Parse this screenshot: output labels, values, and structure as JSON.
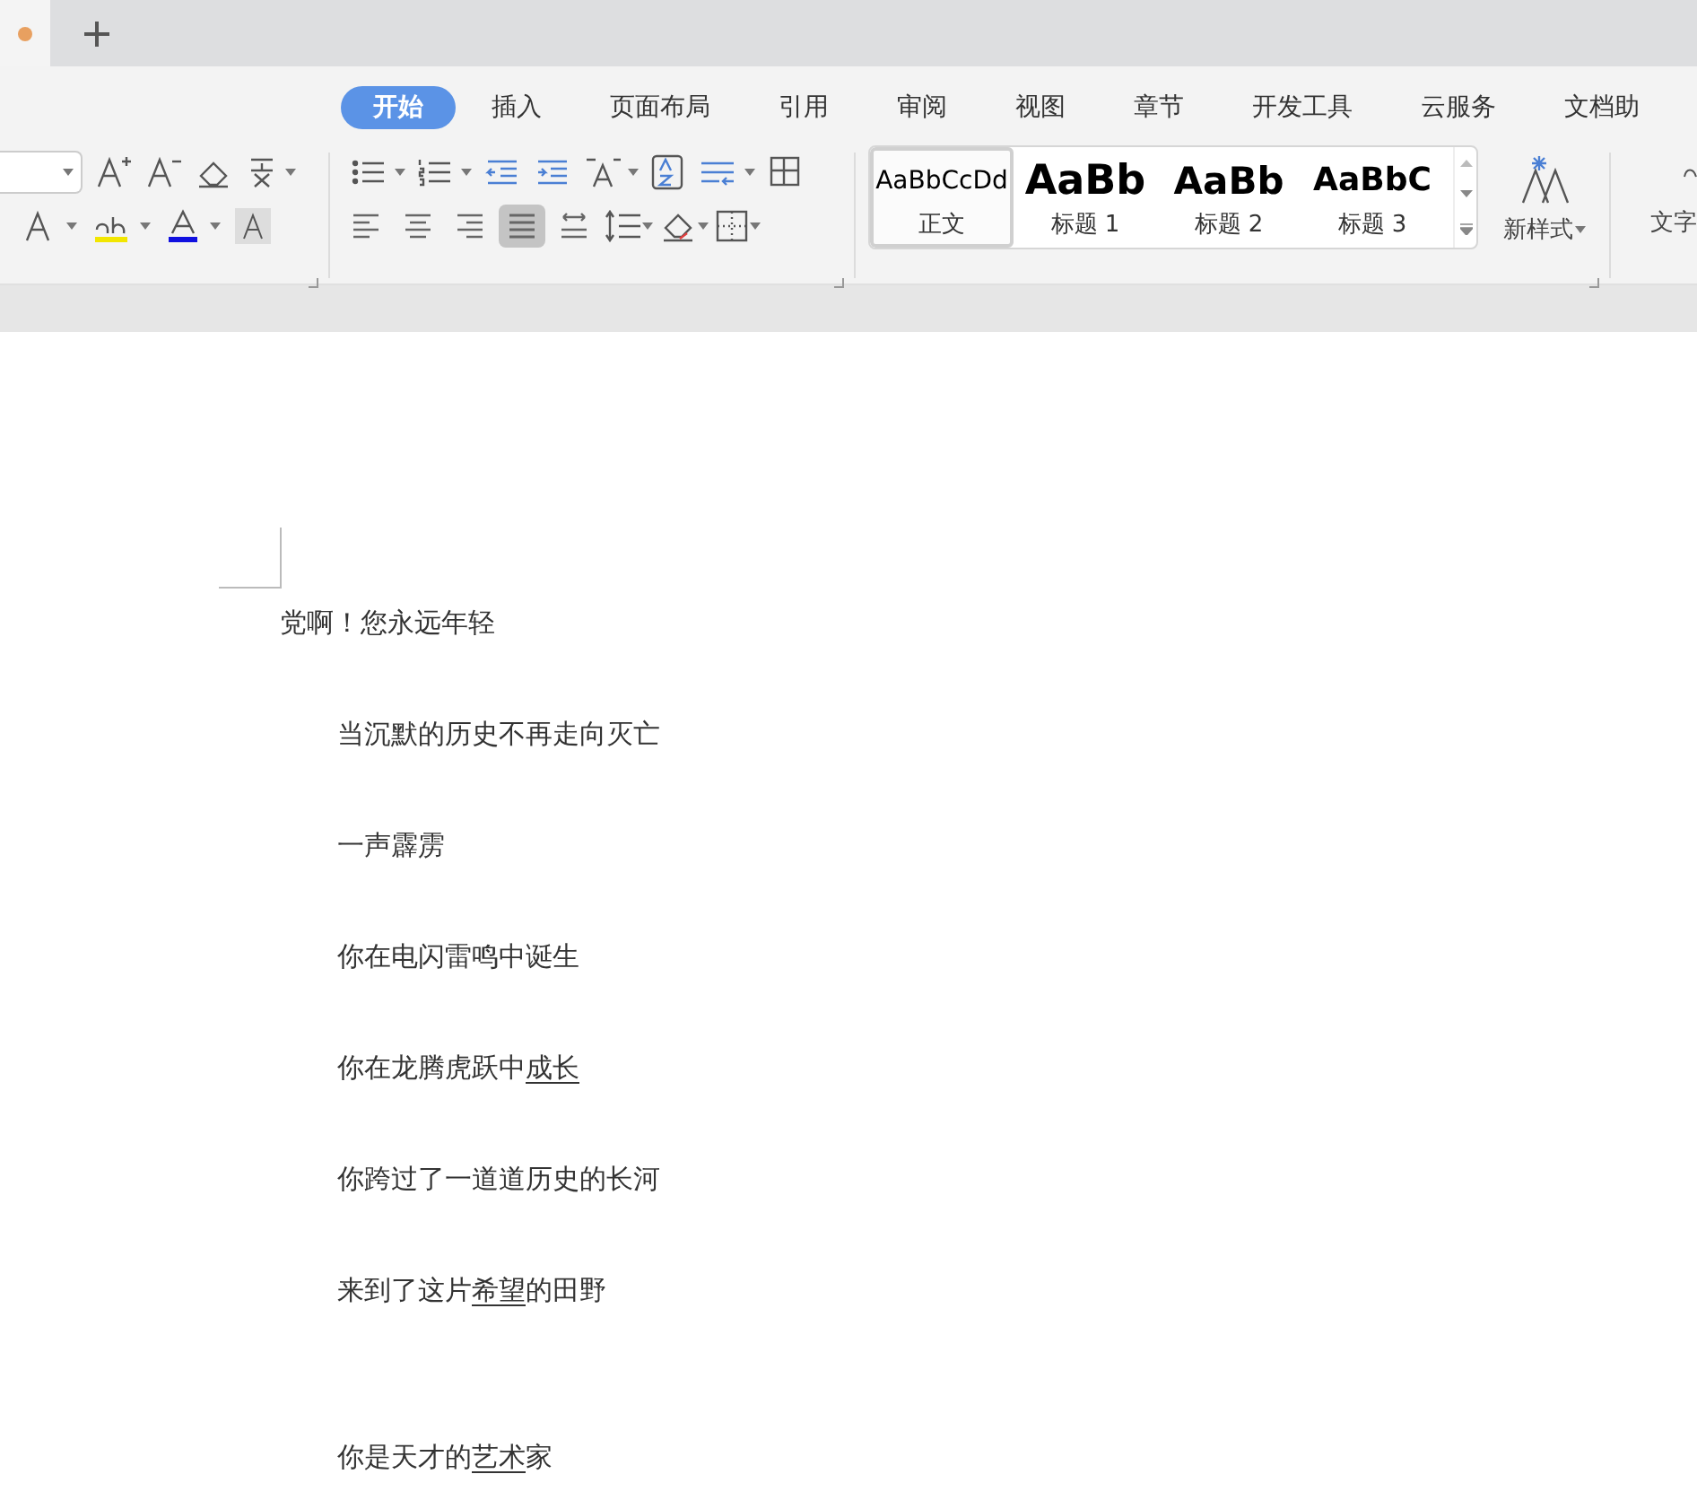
{
  "document_tab": {
    "modified": true
  },
  "ribbon_tabs": [
    {
      "label": "开始",
      "selected": true
    },
    {
      "label": "插入",
      "selected": false
    },
    {
      "label": "页面布局",
      "selected": false
    },
    {
      "label": "引用",
      "selected": false
    },
    {
      "label": "审阅",
      "selected": false
    },
    {
      "label": "视图",
      "selected": false
    },
    {
      "label": "章节",
      "selected": false
    },
    {
      "label": "开发工具",
      "selected": false
    },
    {
      "label": "云服务",
      "selected": false
    },
    {
      "label": "文档助",
      "selected": false
    }
  ],
  "paragraph_align": [
    {
      "selected": false
    },
    {
      "selected": false
    },
    {
      "selected": false
    },
    {
      "selected": true
    },
    {
      "selected": false
    }
  ],
  "styles": [
    {
      "preview": "AaBbCcDd",
      "label": "正文",
      "kind": "body",
      "selected": true
    },
    {
      "preview": "AaBb",
      "label": "标题 1",
      "kind": "heading1",
      "selected": false
    },
    {
      "preview": "AaBb",
      "label": "标题 2",
      "kind": "heading2",
      "selected": false
    },
    {
      "preview": "AaBbC",
      "label": "标题 3",
      "kind": "heading3",
      "selected": false
    }
  ],
  "new_style": {
    "label": "新样式"
  },
  "text_tool": {
    "label": "文字"
  },
  "document": {
    "title": "党啊！您永远年轻",
    "stanzas": [
      [
        [
          {
            "text": "当沉默的历史不再走向灭亡",
            "underlined": false
          }
        ],
        [
          {
            "text": "一声霹雳",
            "underlined": false
          }
        ],
        [
          {
            "text": "你在电闪雷鸣中诞生",
            "underlined": false
          }
        ],
        [
          {
            "text": "你在龙腾虎跃中",
            "underlined": false
          },
          {
            "text": "成长",
            "underlined": true
          }
        ],
        [
          {
            "text": "你跨过了一道道历史的长河",
            "underlined": false
          }
        ],
        [
          {
            "text": "来到了这片",
            "underlined": false
          },
          {
            "text": "希望",
            "underlined": true
          },
          {
            "text": "的田野",
            "underlined": false
          }
        ]
      ],
      [
        [
          {
            "text": "你是天才的",
            "underlined": false
          },
          {
            "text": "艺术",
            "underlined": true
          },
          {
            "text": "家",
            "underlined": false
          }
        ]
      ]
    ]
  }
}
